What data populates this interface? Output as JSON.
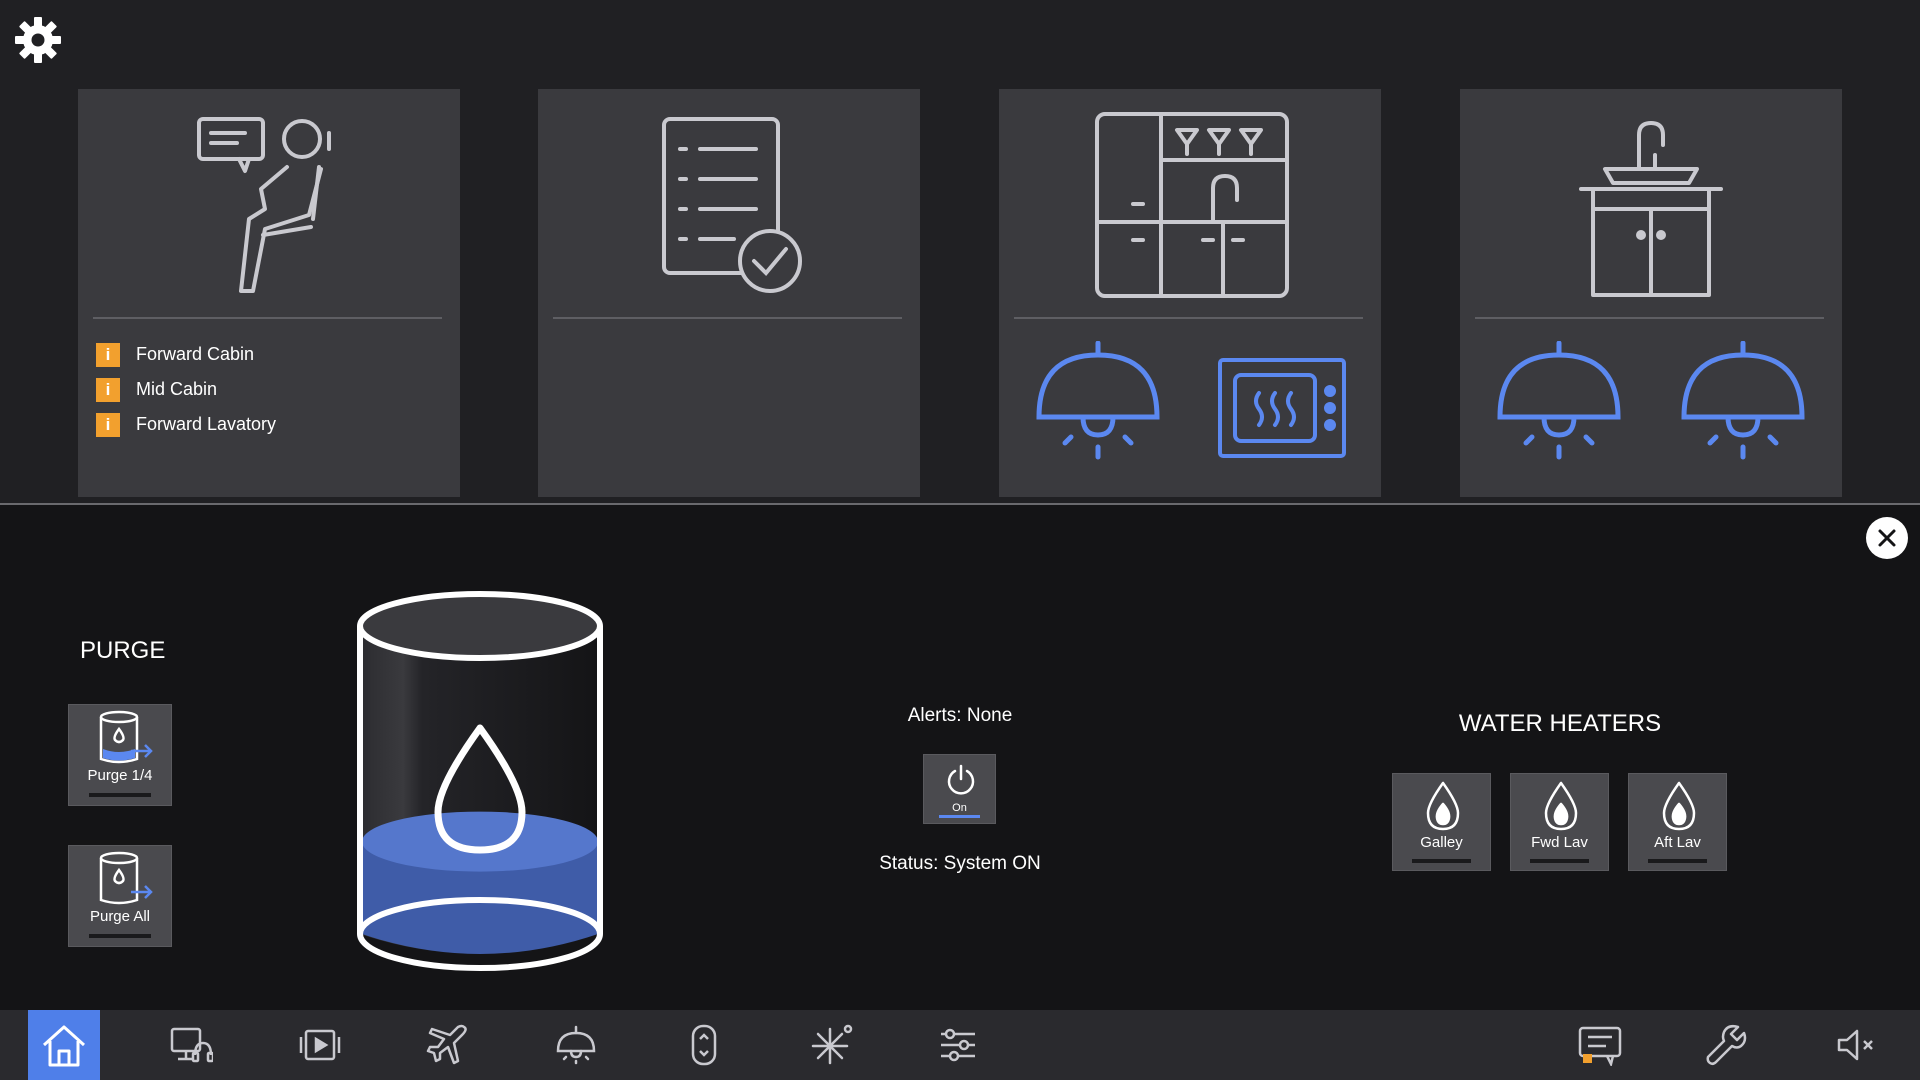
{
  "colors": {
    "accent": "#4f7fe9",
    "control_blue": "#5b88f0",
    "alert_orange": "#f2a02e",
    "card_bg": "#3a3a3e",
    "panel_bg": "#141416",
    "water_blue": "#3f5ca8"
  },
  "top": {
    "settings_icon": "gear-icon",
    "cards": [
      {
        "icon": "passenger-seat-chat-icon",
        "alerts": [
          {
            "badge": "i",
            "label": "Forward Cabin"
          },
          {
            "badge": "i",
            "label": "Mid Cabin"
          },
          {
            "badge": "i",
            "label": "Forward Lavatory"
          }
        ]
      },
      {
        "icon": "checklist-icon"
      },
      {
        "icon": "galley-icon",
        "controls": [
          "pendant-light-icon",
          "oven-icon"
        ]
      },
      {
        "icon": "lavatory-sink-icon",
        "controls": [
          "pendant-light-icon",
          "pendant-light-icon"
        ]
      }
    ]
  },
  "panel": {
    "purge": {
      "title": "PURGE",
      "buttons": [
        {
          "label": "Purge 1/4",
          "icon": "tank-purge-icon"
        },
        {
          "label": "Purge All",
          "icon": "tank-purge-icon"
        }
      ]
    },
    "tank": {
      "icon": "water-tank-icon",
      "fill_level": 0.3
    },
    "water_system": {
      "alerts_text": "Alerts: None",
      "power_label": "On",
      "power_icon": "power-icon",
      "status_text": "Status: System ON"
    },
    "heaters": {
      "title": "WATER HEATERS",
      "buttons": [
        {
          "label": "Galley",
          "icon": "flame-drop-icon"
        },
        {
          "label": "Fwd Lav",
          "icon": "flame-drop-icon"
        },
        {
          "label": "Aft Lav",
          "icon": "flame-drop-icon"
        }
      ]
    }
  },
  "nav": {
    "items": [
      {
        "icon": "home-icon",
        "active": true
      },
      {
        "icon": "monitor-headphones-icon"
      },
      {
        "icon": "media-player-icon"
      },
      {
        "icon": "airplane-icon"
      },
      {
        "icon": "cabin-light-icon"
      },
      {
        "icon": "window-shade-icon"
      },
      {
        "icon": "climate-icon"
      },
      {
        "icon": "sliders-icon"
      },
      {
        "icon": "messages-icon"
      },
      {
        "icon": "wrench-icon"
      },
      {
        "icon": "mute-icon"
      }
    ]
  }
}
